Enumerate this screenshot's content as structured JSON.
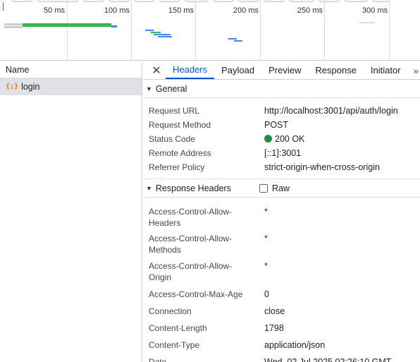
{
  "timeline": {
    "ticks": [
      "50 ms",
      "100 ms",
      "150 ms",
      "200 ms",
      "250 ms",
      "300 ms"
    ],
    "colors": {
      "waiting": "#2eb84f",
      "queue": "#4285f4",
      "light": "#c9ccd1"
    }
  },
  "request_list": {
    "header": "Name",
    "items": [
      {
        "icon": "{;}",
        "icon_name": "fetch-icon",
        "name": "login"
      }
    ]
  },
  "detail": {
    "close_label": "✕",
    "tabs": [
      "Headers",
      "Payload",
      "Preview",
      "Response",
      "Initiator"
    ],
    "active_tab": "Headers",
    "more_label": "»",
    "general": {
      "title": "General",
      "rows": [
        {
          "key": "Request URL",
          "value": "http://localhost:3001/api/auth/login"
        },
        {
          "key": "Request Method",
          "value": "POST"
        },
        {
          "key": "Status Code",
          "value": "200 OK"
        },
        {
          "key": "Remote Address",
          "value": "[::1]:3001"
        },
        {
          "key": "Referrer Policy",
          "value": "strict-origin-when-cross-origin"
        }
      ]
    },
    "response_headers": {
      "title": "Response Headers",
      "raw_label": "Raw",
      "raw_checked": false,
      "rows": [
        {
          "key": "Access-Control-Allow-Headers",
          "value": "*"
        },
        {
          "key": "Access-Control-Allow-Methods",
          "value": "*"
        },
        {
          "key": "Access-Control-Allow-Origin",
          "value": "*"
        },
        {
          "key": "Access-Control-Max-Age",
          "value": "0"
        },
        {
          "key": "Connection",
          "value": "close"
        },
        {
          "key": "Content-Length",
          "value": "1798"
        },
        {
          "key": "Content-Type",
          "value": "application/json"
        },
        {
          "key": "Date",
          "value": "Wed, 02 Jul 2025 02:26:10 GMT"
        }
      ]
    }
  }
}
